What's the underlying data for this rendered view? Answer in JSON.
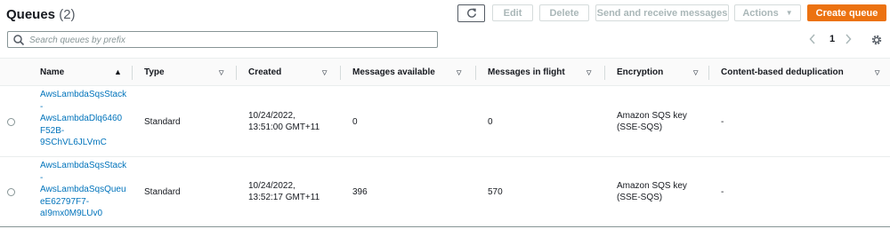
{
  "header": {
    "title": "Queues",
    "count": "(2)"
  },
  "toolbar": {
    "refresh_icon": "refresh-icon",
    "edit_label": "Edit",
    "delete_label": "Delete",
    "send_label": "Send and receive messages",
    "actions_label": "Actions",
    "create_label": "Create queue",
    "create_color": "#ec7211"
  },
  "search": {
    "placeholder": "Search queues by prefix",
    "value": ""
  },
  "pagination": {
    "page": "1"
  },
  "table": {
    "columns": [
      {
        "label": "Name",
        "sort": "ascending"
      },
      {
        "label": "Type"
      },
      {
        "label": "Created"
      },
      {
        "label": "Messages available"
      },
      {
        "label": "Messages in flight"
      },
      {
        "label": "Encryption"
      },
      {
        "label": "Content-based deduplication"
      }
    ],
    "rows": [
      {
        "name_lines": [
          "AwsLambdaSqsStack",
          "-",
          "AwsLambdaDlq6460",
          "F52B-",
          "9SChVL6JLVmC"
        ],
        "type": "Standard",
        "created_line1": "10/24/2022,",
        "created_line2": "13:51:00 GMT+11",
        "messages_available": "0",
        "messages_in_flight": "0",
        "encryption_line1": "Amazon SQS key",
        "encryption_line2": "(SSE-SQS)",
        "dedup": "-"
      },
      {
        "name_lines": [
          "AwsLambdaSqsStack",
          "-",
          "AwsLambdaSqsQueu",
          "eE62797F7-",
          "aI9mx0M9LUv0"
        ],
        "type": "Standard",
        "created_line1": "10/24/2022,",
        "created_line2": "13:52:17 GMT+11",
        "messages_available": "396",
        "messages_in_flight": "570",
        "encryption_line1": "Amazon SQS key",
        "encryption_line2": "(SSE-SQS)",
        "dedup": "-"
      }
    ]
  }
}
